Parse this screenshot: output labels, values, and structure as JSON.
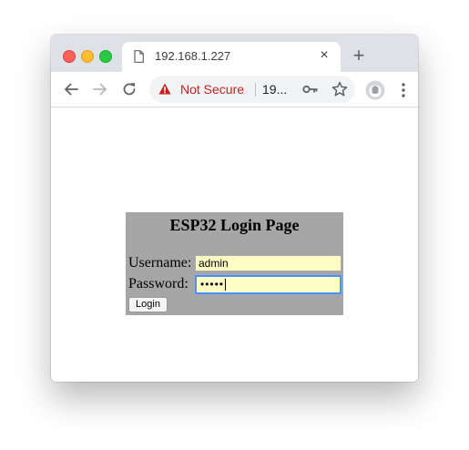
{
  "browser": {
    "tab": {
      "title": "192.168.1.227",
      "close_glyph": "×"
    },
    "new_tab_glyph": "+",
    "toolbar": {
      "security_label": "Not Secure",
      "url_display": "19...",
      "icons": [
        "back-arrow-icon",
        "forward-arrow-icon",
        "reload-icon",
        "warning-icon",
        "key-icon",
        "star-icon",
        "profile-icon",
        "menu-dots-icon"
      ]
    },
    "colors": {
      "tabstrip": "#dee1e6",
      "security_red": "#c5221f",
      "focus_blue": "#4d90fe"
    }
  },
  "page": {
    "title": "ESP32 Login Page",
    "username_label": "Username:",
    "username_value": "admin",
    "password_label": "Password:",
    "password_mask": "•••••",
    "login_button": "Login",
    "colors": {
      "form_background": "#a6a6a6",
      "autofill_yellow": "#fbfdc5"
    }
  }
}
